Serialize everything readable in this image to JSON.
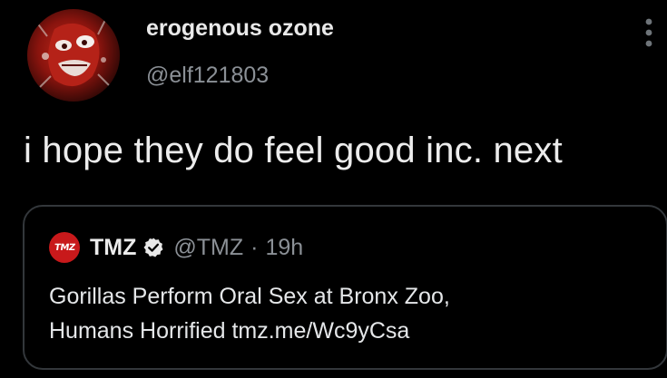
{
  "tweet": {
    "author": {
      "display_name": "erogenous ozone",
      "handle": "@elf121803",
      "avatar": "red-distorted-face-avatar"
    },
    "menu_icon": "more-vertical-icon",
    "text": "i hope they do feel good inc. next"
  },
  "quoted_tweet": {
    "avatar_text": "TMZ",
    "author_name": "TMZ",
    "verified_icon": "verified-badge-icon",
    "handle": "@TMZ",
    "separator": "·",
    "time": "19h",
    "text_lines": [
      "Gorillas Perform Oral Sex at Bronx Zoo,",
      "Humans Horrified tmz.me/Wc9yCsa"
    ]
  },
  "colors": {
    "background": "#000000",
    "text_primary": "#e7e9ea",
    "text_secondary": "#8b9096",
    "card_border": "#33373b",
    "tmz_red": "#c8191b"
  }
}
